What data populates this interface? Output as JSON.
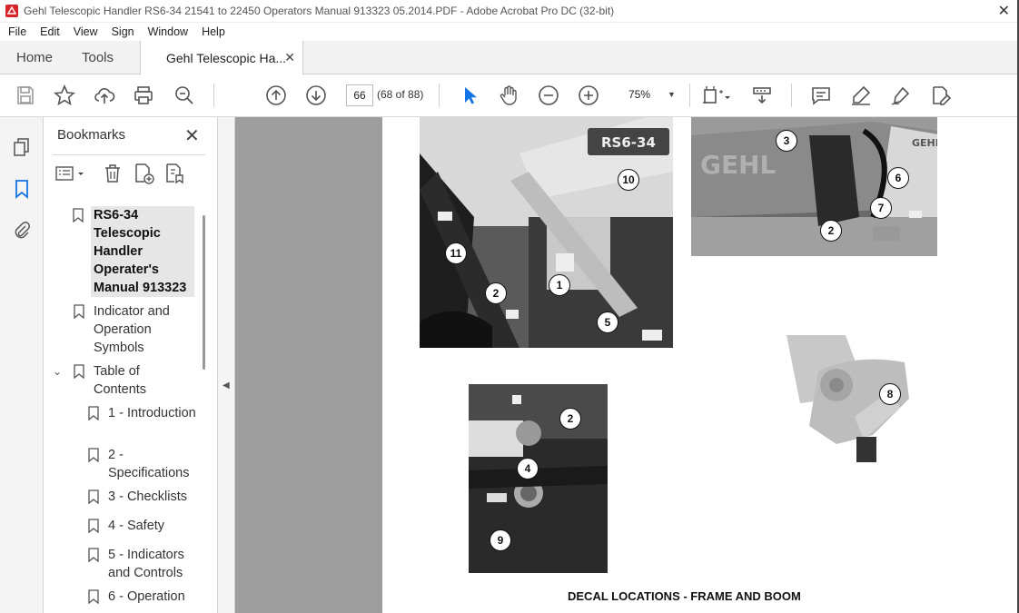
{
  "window": {
    "title": "Gehl Telescopic Handler RS6-34 21541 to 22450 Operators Manual 913323 05.2014.PDF - Adobe Acrobat Pro DC (32-bit)",
    "close_glyph": "✕"
  },
  "menu": [
    "File",
    "Edit",
    "View",
    "Sign",
    "Window",
    "Help"
  ],
  "tabs": {
    "home": "Home",
    "tools": "Tools",
    "document": "Gehl Telescopic Ha...",
    "close_glyph": "✕"
  },
  "toolbar": {
    "page_number": "66",
    "page_count": "(68 of 88)",
    "zoom": "75%"
  },
  "bookmarks": {
    "title": "Bookmarks",
    "close_glyph": "✕",
    "items": [
      {
        "label": "RS6-34 Telescopic Handler Operater's Manual 913323",
        "selected": true
      },
      {
        "label": "Indicator and Operation Symbols"
      },
      {
        "label": "Table of Contents",
        "expanded": true
      },
      {
        "label": "1 - Introduction"
      },
      {
        "label": "2 - Specifications"
      },
      {
        "label": "3 - Checklists"
      },
      {
        "label": "4 - Safety"
      },
      {
        "label": "5 - Indicators and Controls"
      },
      {
        "label": "6 - Operation"
      }
    ]
  },
  "document": {
    "boom_badge": "RS6-34",
    "brand_badge": "GEHL",
    "callouts_photo1": [
      "10",
      "11",
      "1",
      "2",
      "5"
    ],
    "callouts_photo2": [
      "3",
      "6",
      "7",
      "2"
    ],
    "callouts_photo3": [
      "2",
      "4",
      "9"
    ],
    "callouts_photo4": [
      "8"
    ],
    "caption": "DECAL LOCATIONS - FRAME AND BOOM"
  },
  "colors": {
    "accent": "#1473e6",
    "acrobat_red": "#d7262b",
    "viewer_bg": "#9d9d9d"
  }
}
